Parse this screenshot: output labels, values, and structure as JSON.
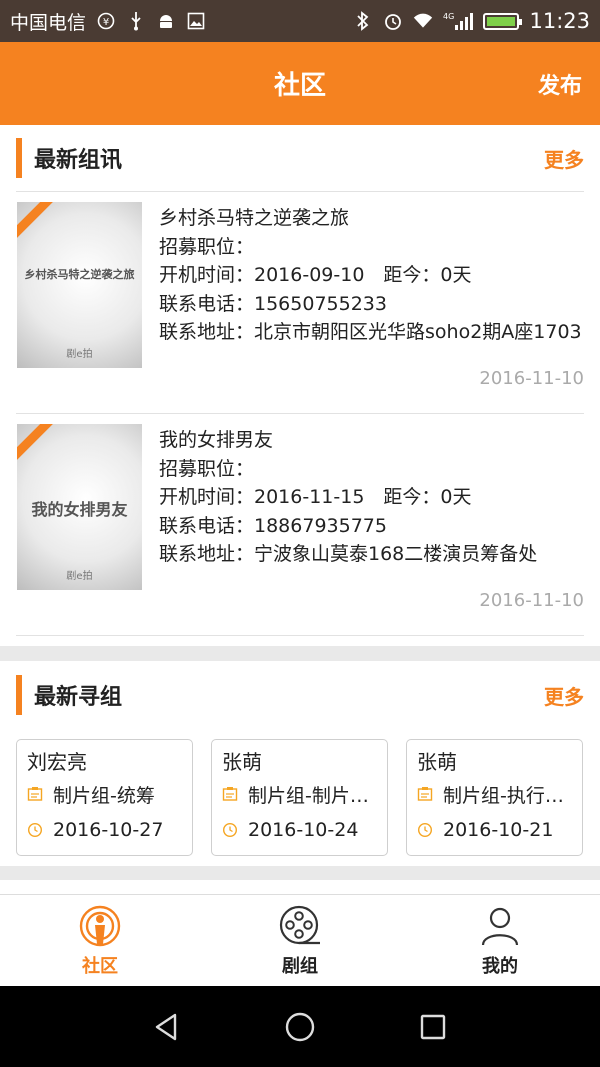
{
  "status_bar": {
    "carrier": "中国电信",
    "time": "11:23",
    "network": "4G"
  },
  "header": {
    "title": "社区",
    "publish_label": "发布"
  },
  "latest_news": {
    "title": "最新组讯",
    "more_label": "更多",
    "items": [
      {
        "poster_title": "乡村杀马特之逆袭之旅",
        "poster_brand": "剧e拍",
        "title": "乡村杀马特之逆袭之旅",
        "position_label": "招募职位：",
        "start": "开机时间：2016-09-10　距今：0天",
        "phone": "联系电话：15650755233",
        "address": "联系地址：北京市朝阳区光华路soho2期A座1703",
        "date": "2016-11-10"
      },
      {
        "poster_title": "我的女排男友",
        "poster_brand": "剧e拍",
        "title": "我的女排男友",
        "position_label": "招募职位：",
        "start": "开机时间：2016-11-15　距今：0天",
        "phone": "联系电话：18867935775",
        "address": "联系地址：宁波象山莫泰168二楼演员筹备处",
        "date": "2016-11-10"
      }
    ]
  },
  "latest_seek": {
    "title": "最新寻组",
    "more_label": "更多",
    "cards": [
      {
        "name": "刘宏亮",
        "role": "制片组-统筹",
        "date": "2016-10-27"
      },
      {
        "name": "张萌",
        "role": "制片组-制片主任",
        "date": "2016-10-24"
      },
      {
        "name": "张萌",
        "role": "制片组-执行制片",
        "date": "2016-10-21"
      }
    ]
  },
  "bottom_nav": [
    {
      "label": "社区",
      "icon": "community-icon",
      "active": true
    },
    {
      "label": "剧组",
      "icon": "film-reel-icon",
      "active": false
    },
    {
      "label": "我的",
      "icon": "person-icon",
      "active": false
    }
  ],
  "colors": {
    "accent": "#f58220",
    "status_bar": "#4a3b33"
  }
}
